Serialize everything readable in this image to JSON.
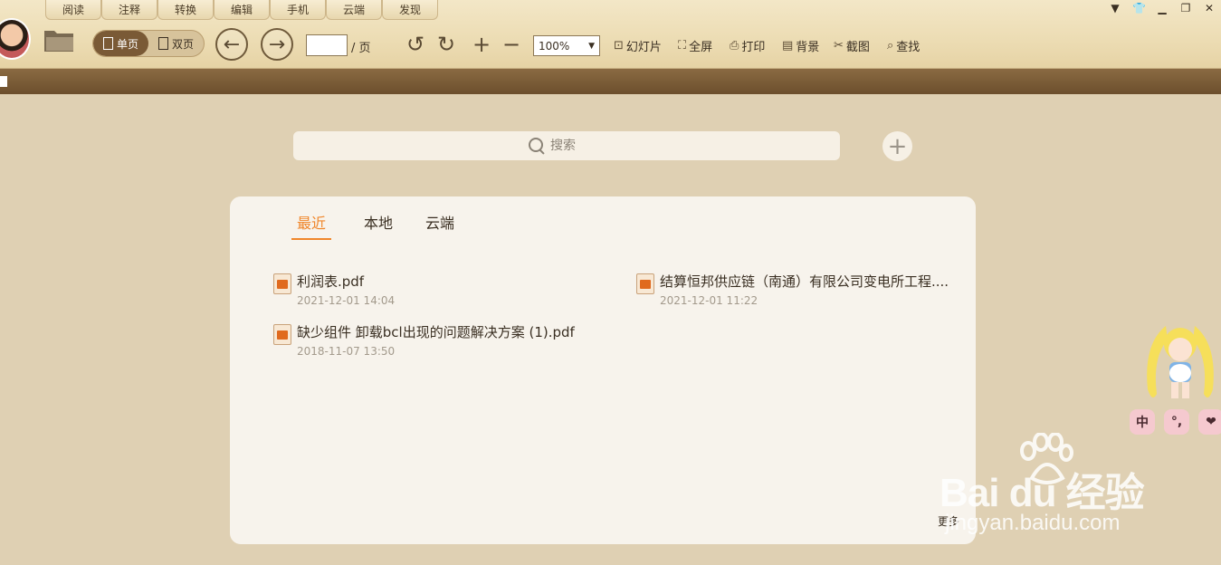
{
  "menu": {
    "tabs": [
      "阅读",
      "注释",
      "转换",
      "编辑",
      "手机",
      "云端",
      "发现"
    ]
  },
  "toolbar": {
    "single_page": "单页",
    "double_page": "双页",
    "page_input": "",
    "page_suffix": "/ 页",
    "zoom": "100%",
    "slideshow": "幻灯片",
    "fullscreen": "全屏",
    "print": "打印",
    "background": "背景",
    "screenshot": "截图",
    "find": "查找"
  },
  "search": {
    "placeholder": "搜索"
  },
  "library": {
    "tabs": [
      "最近",
      "本地",
      "云端"
    ],
    "active_tab": "最近",
    "files": [
      {
        "name": "利润表.pdf",
        "date": "2021-12-01 14:04"
      },
      {
        "name": "结算恒邦供应链（南通）有限公司变电所工程....",
        "date": "2021-12-01 11:22"
      },
      {
        "name": "缺少组件 卸载bcl出现的问题解决方案 (1).pdf",
        "date": "2018-11-07 13:50"
      }
    ],
    "more": "更多"
  },
  "ime": {
    "keys": [
      "中",
      "°,",
      "❤"
    ]
  },
  "watermark": {
    "brand": "Bai du 经验",
    "url": "jingyan.baidu.com"
  },
  "colors": {
    "accent": "#f0862a",
    "chrome_bar": "#6c4f2d",
    "background": "#dfd0b3"
  }
}
